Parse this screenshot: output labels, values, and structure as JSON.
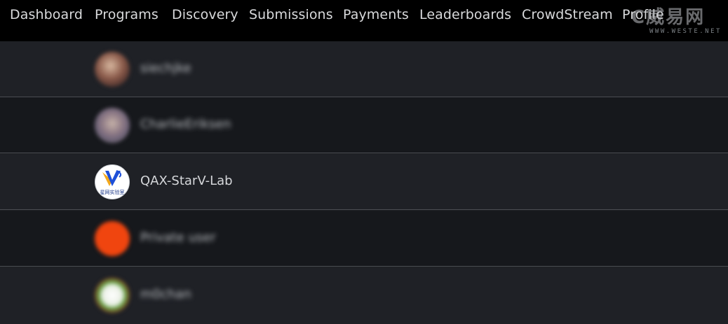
{
  "nav": {
    "items": [
      "Dashboard",
      "Programs",
      "Discovery",
      "Submissions",
      "Payments",
      "Leaderboards",
      "CrowdStream",
      "Profile"
    ]
  },
  "watermark": {
    "logo": "C威易网",
    "url": "WWW.WESTE.NET"
  },
  "leaderboard": {
    "rows": [
      {
        "name": "siechjke",
        "avatar": "user-photo-icon",
        "blurred": true
      },
      {
        "name": "CharlieEriksen",
        "avatar": "user-photo-icon",
        "blurred": true
      },
      {
        "name": "QAX-StarV-Lab",
        "avatar": "starv-lab-logo-icon",
        "blurred": false,
        "logo_caption": "星网实验室"
      },
      {
        "name": "Private user",
        "avatar": "private-user-icon",
        "blurred": true
      },
      {
        "name": "m0chan",
        "avatar": "user-photo-icon",
        "blurred": true
      }
    ]
  },
  "colors": {
    "nav_bg": "#000000",
    "row_dark": "#16181c",
    "row_light": "#1f2126",
    "private_avatar": "#f0450f",
    "starv_blue": "#1d4fd8",
    "starv_gold": "#f2a81d"
  }
}
